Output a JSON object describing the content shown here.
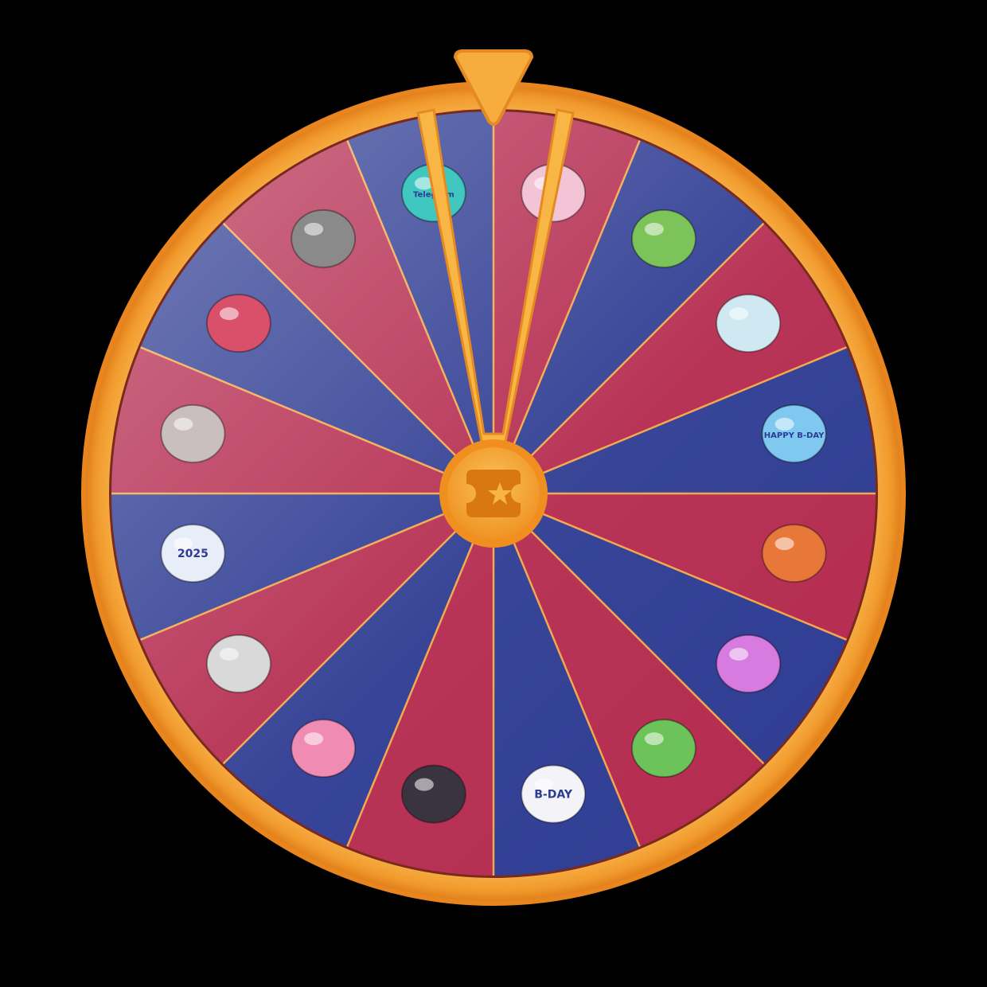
{
  "wheel": {
    "colors": {
      "red": "#b42a4e",
      "blue": "#2d3b92",
      "rim": "#f6a93b",
      "rim_dark": "#e07f1c",
      "divider": "#f4a447",
      "hub": "#f3a030",
      "hub_inner": "#f8b541",
      "background": "#000000"
    },
    "segments": [
      {
        "index": 0,
        "color": "red",
        "prize_icon": "lollipop-icon"
      },
      {
        "index": 1,
        "color": "blue",
        "prize_icon": "pepe-frog-heart-icon"
      },
      {
        "index": 2,
        "color": "red",
        "prize_icon": "crystal-cluster-icon"
      },
      {
        "index": 3,
        "color": "blue",
        "prize_icon": "happy-bday-sign-icon",
        "label": "HAPPY B-DAY"
      },
      {
        "index": 4,
        "color": "red",
        "prize_icon": "orange-handbag-icon"
      },
      {
        "index": 5,
        "color": "blue",
        "prize_icon": "love-potion-icon"
      },
      {
        "index": 6,
        "color": "red",
        "prize_icon": "kissed-frog-icon"
      },
      {
        "index": 7,
        "color": "blue",
        "prize_icon": "bday-calendar-icon",
        "label": "B-DAY"
      },
      {
        "index": 8,
        "color": "red",
        "prize_icon": "top-hat-icon"
      },
      {
        "index": 9,
        "color": "blue",
        "prize_icon": "pink-teddy-bear-icon"
      },
      {
        "index": 10,
        "color": "red",
        "prize_icon": "signet-ring-icon"
      },
      {
        "index": 11,
        "color": "blue",
        "prize_icon": "snowman-2025-icon",
        "label": "2025"
      },
      {
        "index": 12,
        "color": "red",
        "prize_icon": "pearl-icon"
      },
      {
        "index": 13,
        "color": "blue",
        "prize_icon": "cat-helmet-icon"
      },
      {
        "index": 14,
        "color": "red",
        "prize_icon": "grey-cap-icon"
      },
      {
        "index": 15,
        "color": "blue",
        "prize_icon": "ring-box-icon",
        "label": "Telegram"
      }
    ],
    "hub_icon": "ticket-star-icon",
    "pointer_icon": "pointer-triangle-icon"
  }
}
